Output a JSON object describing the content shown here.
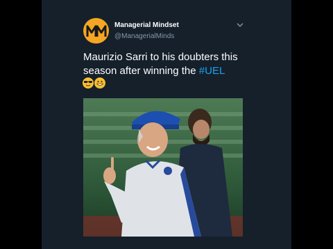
{
  "tweet": {
    "display_name": "Managerial Mindset",
    "handle": "@ManagerialMinds",
    "avatar_text": "MM",
    "text_before_hashtag": "Maurizio Sarri to his doubters this season after winning the ",
    "hashtag": "#UEL",
    "emojis": [
      "sunglasses-face",
      "grinning-face"
    ],
    "media_description": "photo"
  },
  "colors": {
    "background": "#15202b",
    "frame": "#000000",
    "name": "#ffffff",
    "handle": "#8899a6",
    "hashtag": "#1da1f2",
    "avatar": "#f5a623"
  }
}
